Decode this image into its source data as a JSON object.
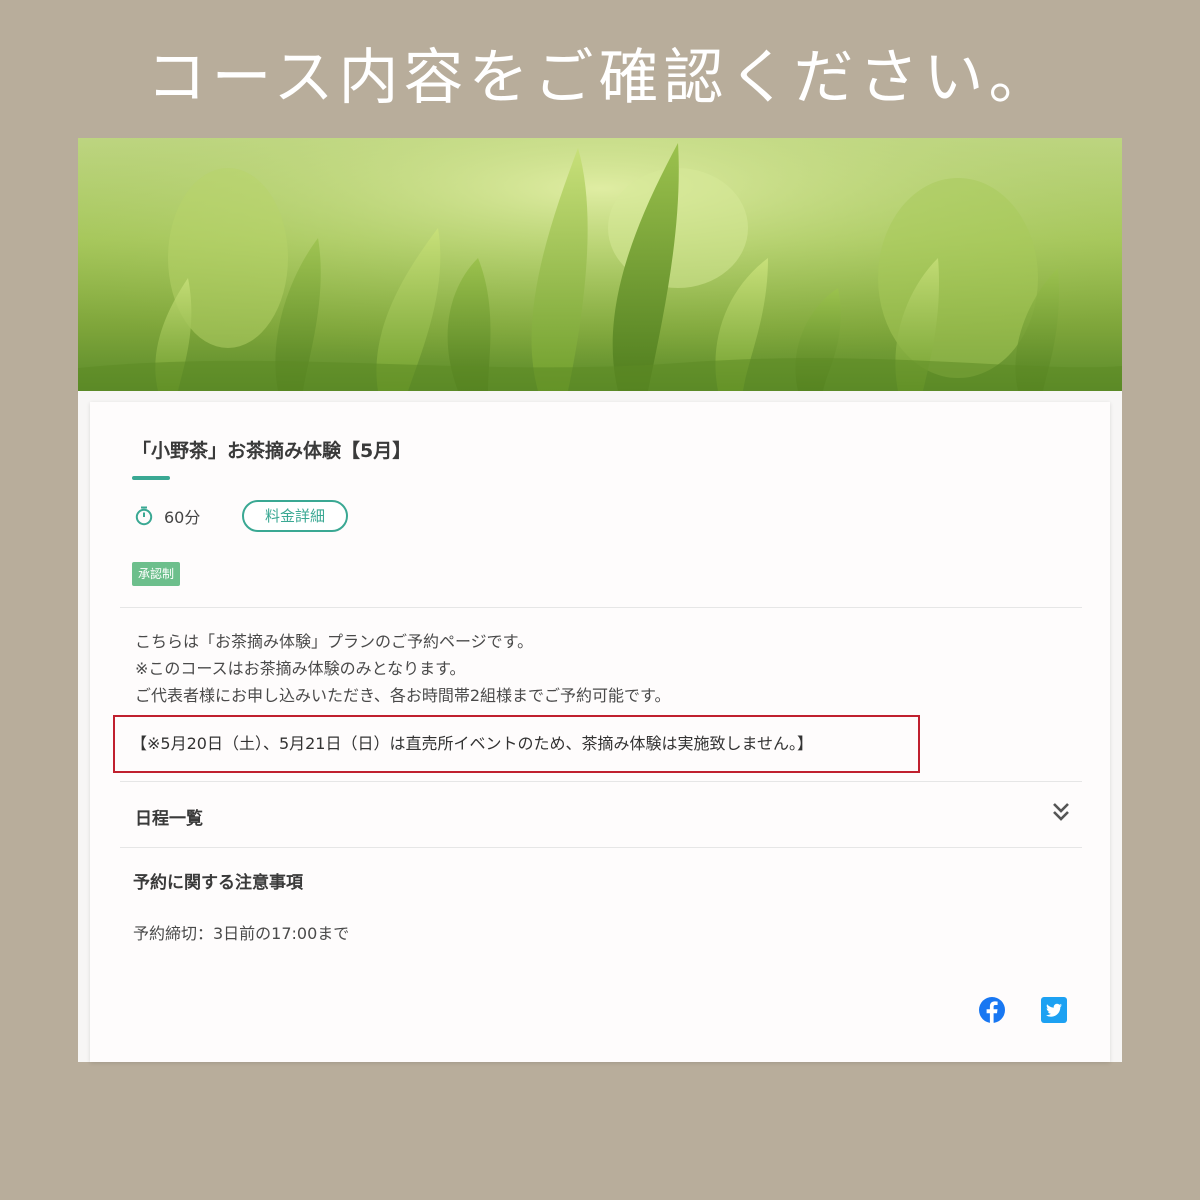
{
  "headline": "コース内容をご確認ください。",
  "course": {
    "title": "「小野茶」お茶摘み体験【5月】",
    "duration": "60分",
    "price_button": "料金詳細",
    "badge": "承認制",
    "description": [
      "こちらは「お茶摘み体験」プランのご予約ページです。",
      "※このコースはお茶摘み体験のみとなります。",
      "ご代表者様にお申し込みいただき、各お時間帯2組様までご予約可能です。"
    ],
    "notice": "【※5月20日（土）、5月21日（日）は直売所イベントのため、茶摘み体験は実施致しません。】",
    "schedule_label": "日程一覧",
    "notes_title": "予約に関する注意事項",
    "deadline": "予約締切：3日前の17:00まで"
  },
  "icons": {
    "timer": "timer-icon",
    "expand": "chevron-double-down-icon",
    "facebook": "facebook-icon",
    "twitter": "twitter-icon"
  },
  "colors": {
    "background": "#b8ad9b",
    "accent": "#3aa893",
    "badge": "#6dbf8c",
    "notice_border": "#c0202e",
    "facebook": "#1877f2",
    "twitter": "#1da1f2"
  }
}
